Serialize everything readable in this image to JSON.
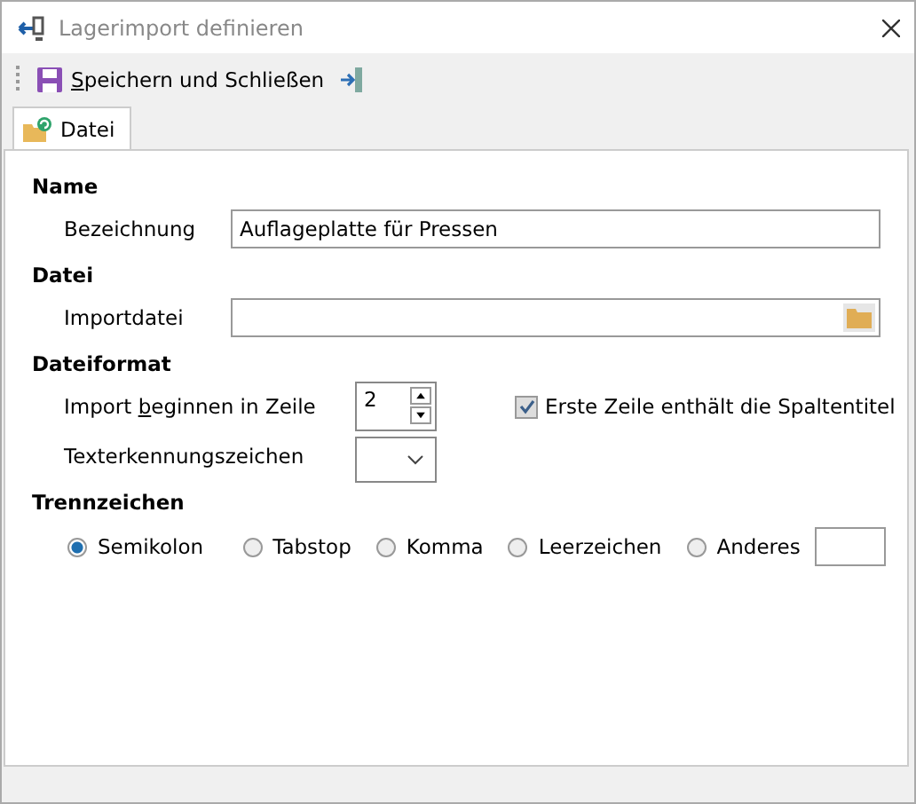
{
  "window": {
    "title": "Lagerimport definieren"
  },
  "toolbar": {
    "save_button": {
      "label_parts": [
        {
          "text": "S",
          "underlined": true
        },
        {
          "text": "peichern und Schließen",
          "underlined": false
        }
      ]
    }
  },
  "tabs": [
    {
      "label": "Datei",
      "selected": true
    }
  ],
  "sections": [
    {
      "heading": "Name",
      "fields": [
        {
          "kind": "text",
          "label": "Bezeichnung",
          "value": "Auflageplatte für Pressen"
        }
      ]
    },
    {
      "heading": "Datei",
      "fields": [
        {
          "kind": "file",
          "label": "Importdatei"
        }
      ]
    },
    {
      "heading": "Dateiformat",
      "fields": [
        {
          "kind": "spinner",
          "label_parts": [
            {
              "text": "Import ",
              "underlined": false
            },
            {
              "text": "b",
              "underlined": true
            },
            {
              "text": "eginnen in Zeile",
              "underlined": false
            }
          ],
          "value": "2",
          "checkbox": {
            "label": "Erste Zeile enthält die Spaltentitel",
            "checked": true,
            "disabled": true
          }
        },
        {
          "kind": "dropdown",
          "label": "Texterkennungszeichen"
        }
      ]
    },
    {
      "heading": "Trennzeichen",
      "fields": [
        {
          "kind": "radios",
          "options": [
            {
              "label": "Semikolon",
              "selected": true
            },
            {
              "label": "Tabstop",
              "selected": false
            },
            {
              "label": "Komma",
              "selected": false
            },
            {
              "label": "Leerzeichen",
              "selected": false
            },
            {
              "label": "Anderes",
              "selected": false,
              "has_input": true
            }
          ]
        }
      ]
    }
  ]
}
